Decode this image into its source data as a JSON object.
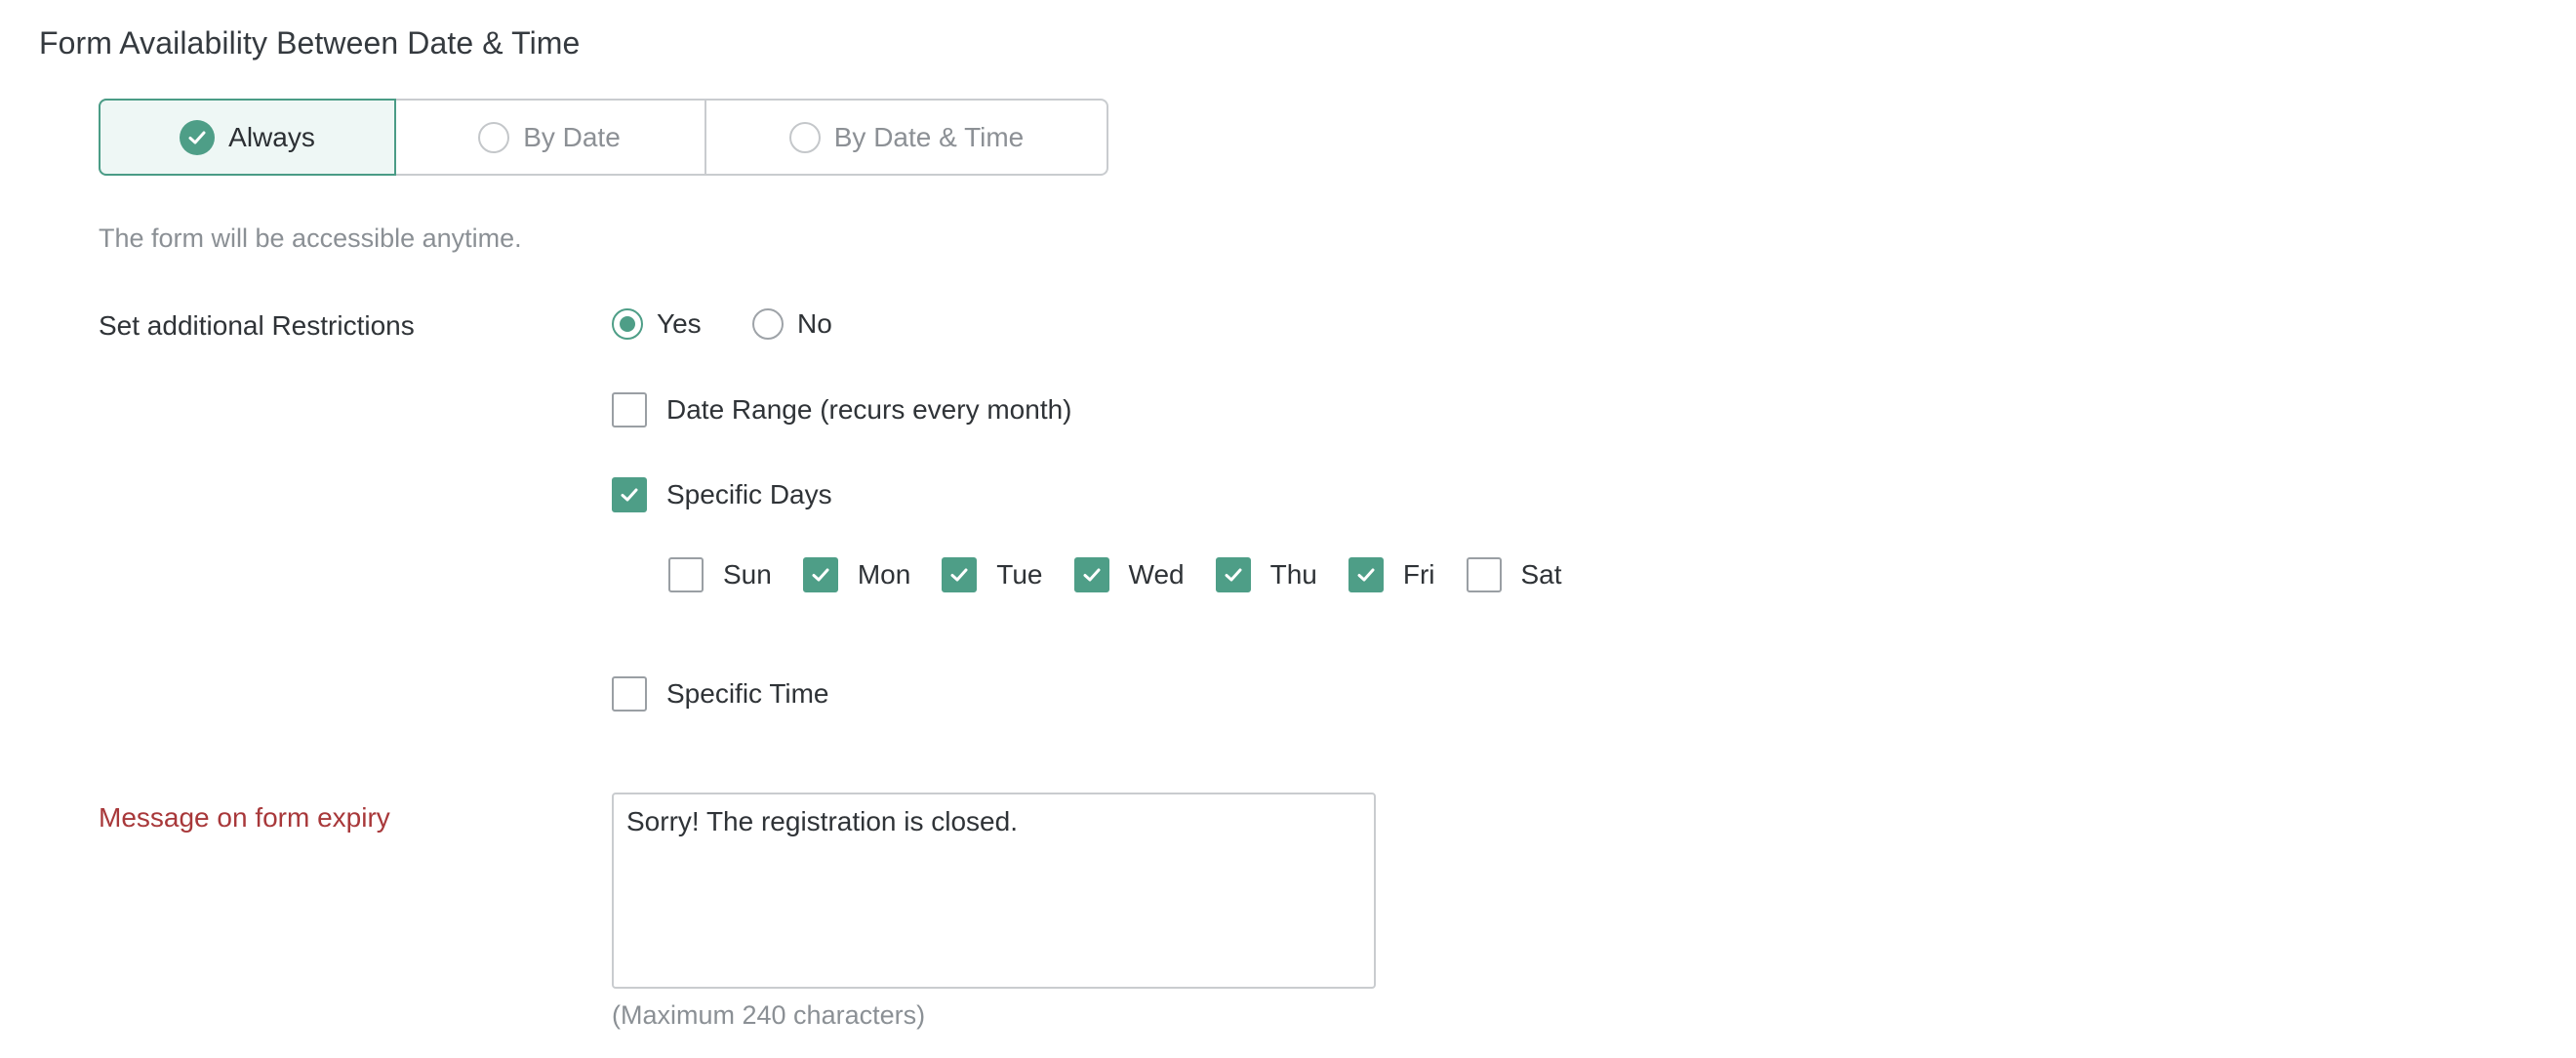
{
  "section_title": "Form Availability Between Date & Time",
  "availability": {
    "options": [
      {
        "label": "Always",
        "selected": true
      },
      {
        "label": "By Date",
        "selected": false
      },
      {
        "label": "By Date & Time",
        "selected": false
      }
    ],
    "description": "The form will be accessible anytime."
  },
  "restrictions": {
    "label": "Set additional Restrictions",
    "yes_label": "Yes",
    "no_label": "No",
    "selected": "Yes",
    "date_range": {
      "label": "Date Range (recurs every month)",
      "checked": false
    },
    "specific_days": {
      "label": "Specific Days",
      "checked": true,
      "days": [
        {
          "label": "Sun",
          "checked": false
        },
        {
          "label": "Mon",
          "checked": true
        },
        {
          "label": "Tue",
          "checked": true
        },
        {
          "label": "Wed",
          "checked": true
        },
        {
          "label": "Thu",
          "checked": true
        },
        {
          "label": "Fri",
          "checked": true
        },
        {
          "label": "Sat",
          "checked": false
        }
      ]
    },
    "specific_time": {
      "label": "Specific Time",
      "checked": false
    }
  },
  "expiry": {
    "label": "Message on form expiry",
    "message": "Sorry! The registration is closed.",
    "hint": "(Maximum 240 characters)"
  },
  "colors": {
    "accent": "#4e9e87",
    "error_label": "#a8383a"
  }
}
